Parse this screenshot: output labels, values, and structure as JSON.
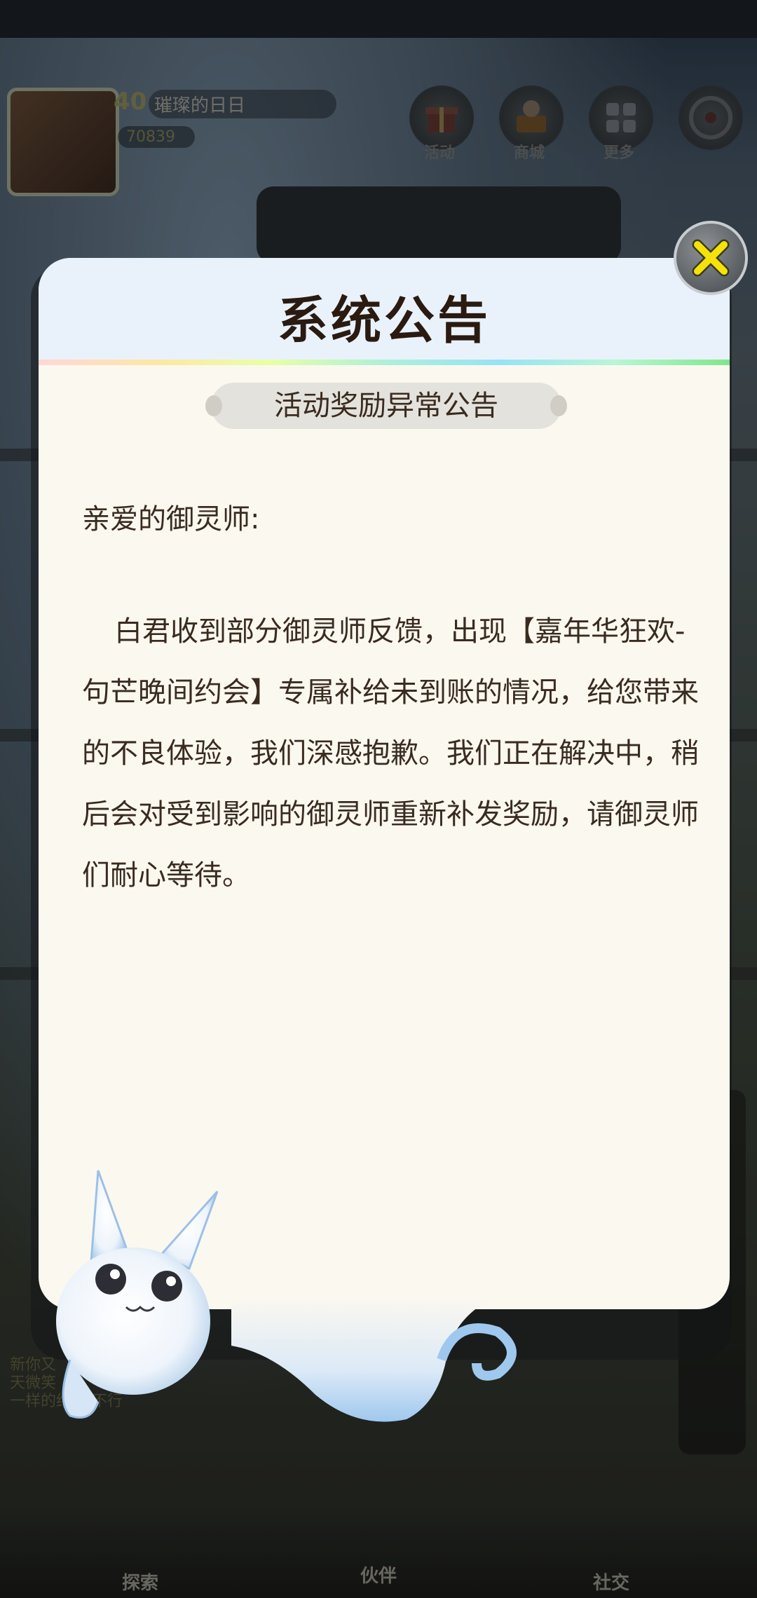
{
  "background": {
    "player": {
      "level": "40",
      "name": "璀璨的日日",
      "gold": "70839"
    },
    "top_buttons": [
      {
        "label": "活动",
        "icon": "gift-icon"
      },
      {
        "label": "商城",
        "icon": "shop-icon"
      },
      {
        "label": "更多",
        "icon": "more-grid-icon"
      },
      {
        "label": "",
        "icon": "radar-icon"
      }
    ],
    "bottom_nav": [
      {
        "label": "探索",
        "icon": "explore-pin-icon"
      },
      {
        "label": "伙伴",
        "icon": "companion-icon"
      },
      {
        "label": "社交",
        "icon": "social-icon"
      }
    ],
    "chat_partial": [
      "新你又",
      "天微笑",
      "一样的结局,不行"
    ]
  },
  "notice": {
    "title": "系统公告",
    "subtitle": "活动奖励异常公告",
    "greeting": "亲爱的御灵师:",
    "body": "白君收到部分御灵师反馈，出现【嘉年华狂欢-句芒晚间约会】专属补给未到账的情况，给您带来的不良体验，我们深感抱歉。我们正在解决中，稍后会对受到影响的御灵师重新补发奖励，请御灵师们耐心等待。"
  },
  "colors": {
    "close_x": "#f5e20a",
    "header_bg": "#e9f2fb",
    "panel_bg": "#fbf8f0",
    "text": "#3a2b20"
  }
}
